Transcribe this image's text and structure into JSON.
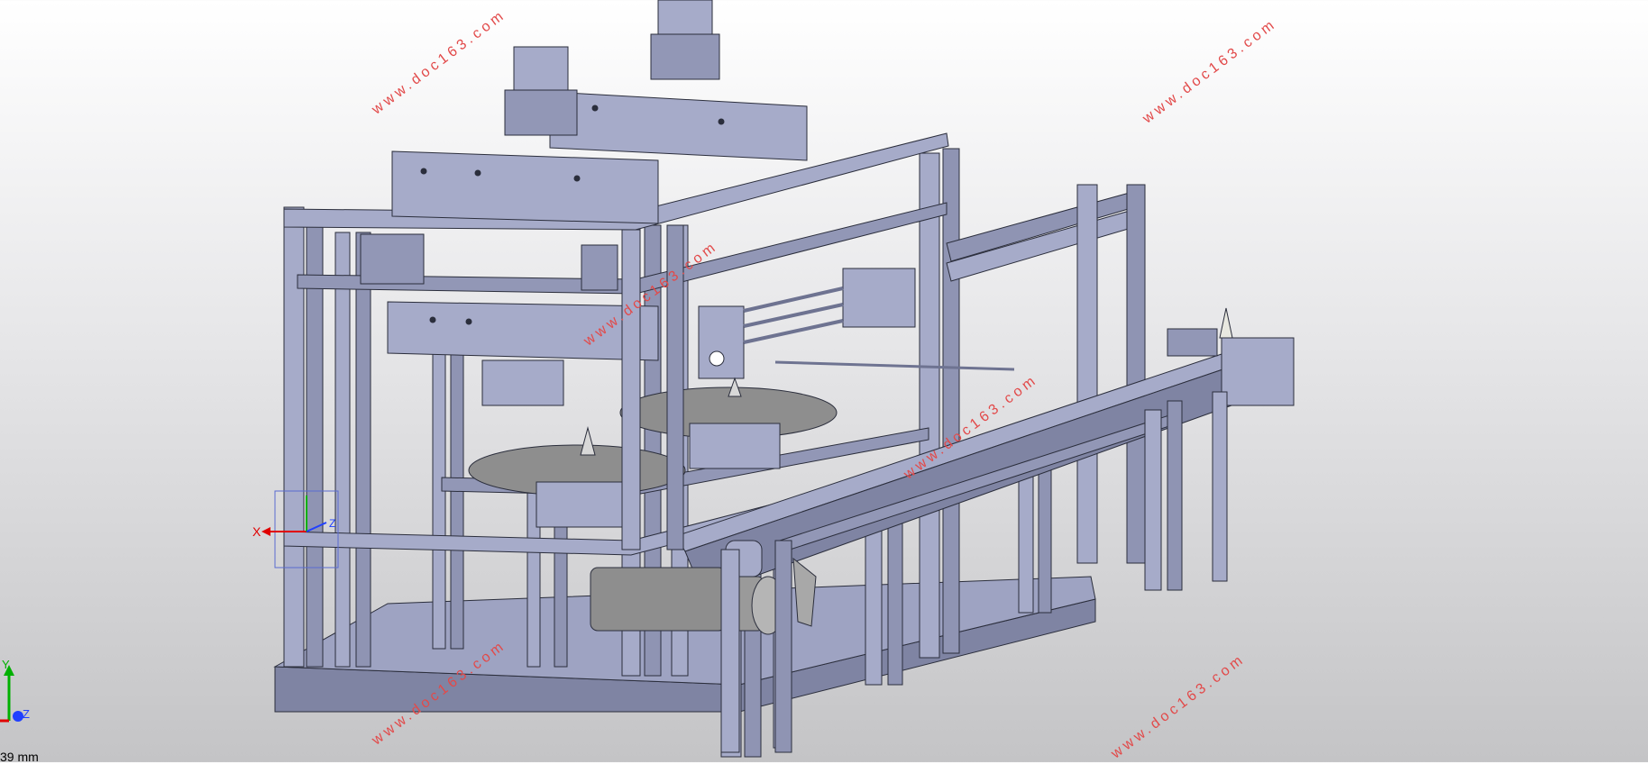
{
  "viewport": {
    "background_top": "#ffffff",
    "background_bottom": "#c4c4c6",
    "model_face_color": "#a6abc9",
    "model_dark_color": "#6e7391",
    "model_edge_color": "#2b2e3c",
    "motor_color": "#8e8e8e"
  },
  "watermark": {
    "text": "www.doc163.com",
    "color": "#e24a4a"
  },
  "coord_triad": {
    "x_label": "X",
    "y_label": "Y",
    "z_label": "Z",
    "x_color": "#e00000",
    "y_color": "#00b000",
    "z_color": "#2040ff"
  },
  "scale_bar": {
    "label": "39 mm"
  }
}
